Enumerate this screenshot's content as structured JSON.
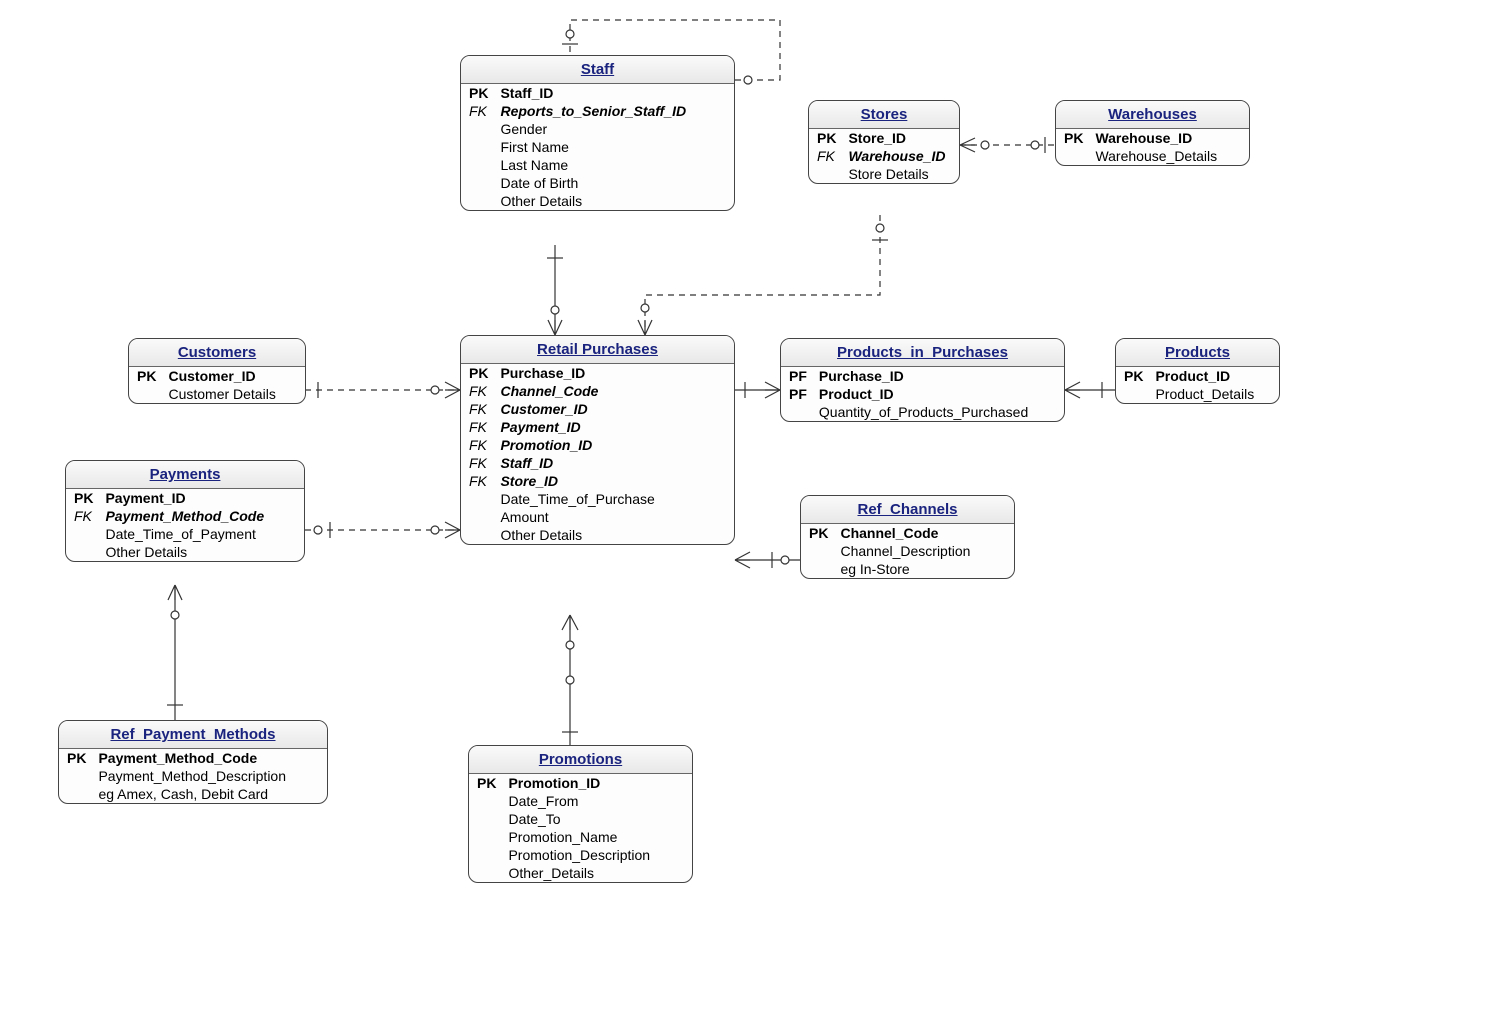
{
  "entities": {
    "staff": {
      "title": "Staff",
      "attrs": [
        {
          "key": "PK",
          "name": "Staff_ID"
        },
        {
          "key": "FK",
          "name": "Reports_to_Senior_Staff_ID",
          "italic": true
        },
        {
          "key": "",
          "name": "Gender",
          "plain": true
        },
        {
          "key": "",
          "name": "First Name",
          "plain": true
        },
        {
          "key": "",
          "name": "Last Name",
          "plain": true
        },
        {
          "key": "",
          "name": "Date of Birth",
          "plain": true
        },
        {
          "key": "",
          "name": "Other Details",
          "plain": true
        }
      ]
    },
    "stores": {
      "title": "Stores",
      "attrs": [
        {
          "key": "PK",
          "name": "Store_ID"
        },
        {
          "key": "FK",
          "name": "Warehouse_ID",
          "italic": true
        },
        {
          "key": "",
          "name": "Store Details",
          "plain": true
        }
      ]
    },
    "warehouses": {
      "title": "Warehouses",
      "attrs": [
        {
          "key": "PK",
          "name": "Warehouse_ID"
        },
        {
          "key": "",
          "name": "Warehouse_Details",
          "plain": true
        }
      ]
    },
    "customers": {
      "title": "Customers",
      "attrs": [
        {
          "key": "PK",
          "name": "Customer_ID"
        },
        {
          "key": "",
          "name": "Customer Details",
          "plain": true
        }
      ]
    },
    "retail_purchases": {
      "title": "Retail Purchases",
      "attrs": [
        {
          "key": "PK",
          "name": "Purchase_ID"
        },
        {
          "key": "FK",
          "name": "Channel_Code",
          "italic": true
        },
        {
          "key": "FK",
          "name": "Customer_ID",
          "italic": true
        },
        {
          "key": "FK",
          "name": "Payment_ID",
          "italic": true
        },
        {
          "key": "FK",
          "name": "Promotion_ID",
          "italic": true
        },
        {
          "key": "FK",
          "name": "Staff_ID",
          "italic": true
        },
        {
          "key": "FK",
          "name": "Store_ID",
          "italic": true
        },
        {
          "key": "",
          "name": "Date_Time_of_Purchase",
          "plain": true
        },
        {
          "key": "",
          "name": "Amount",
          "plain": true
        },
        {
          "key": "",
          "name": "Other Details",
          "plain": true
        }
      ]
    },
    "products_in_purchases": {
      "title": "Products_in_Purchases",
      "attrs": [
        {
          "key": "PF",
          "name": "Purchase_ID"
        },
        {
          "key": "PF",
          "name": "Product_ID"
        },
        {
          "key": "",
          "name": "Quantity_of_Products_Purchased",
          "plain": true
        }
      ]
    },
    "products": {
      "title": "Products",
      "attrs": [
        {
          "key": "PK",
          "name": "Product_ID"
        },
        {
          "key": "",
          "name": "Product_Details",
          "plain": true
        }
      ]
    },
    "payments": {
      "title": "Payments",
      "attrs": [
        {
          "key": "PK",
          "name": "Payment_ID"
        },
        {
          "key": "FK",
          "name": "Payment_Method_Code",
          "italic": true
        },
        {
          "key": "",
          "name": "Date_Time_of_Payment",
          "plain": true
        },
        {
          "key": "",
          "name": "Other Details",
          "plain": true
        }
      ]
    },
    "ref_channels": {
      "title": "Ref_Channels",
      "attrs": [
        {
          "key": "PK",
          "name": "Channel_Code"
        },
        {
          "key": "",
          "name": "Channel_Description",
          "plain": true
        },
        {
          "key": "",
          "name": "eg In-Store",
          "plain": true
        }
      ]
    },
    "ref_payment_methods": {
      "title": "Ref_Payment_Methods",
      "attrs": [
        {
          "key": "PK",
          "name": "Payment_Method_Code"
        },
        {
          "key": "",
          "name": "Payment_Method_Description",
          "plain": true
        },
        {
          "key": "",
          "name": "eg Amex, Cash, Debit Card",
          "plain": true
        }
      ]
    },
    "promotions": {
      "title": "Promotions",
      "attrs": [
        {
          "key": "PK",
          "name": "Promotion_ID"
        },
        {
          "key": "",
          "name": "Date_From",
          "plain": true
        },
        {
          "key": "",
          "name": "Date_To",
          "plain": true
        },
        {
          "key": "",
          "name": "Promotion_Name",
          "plain": true
        },
        {
          "key": "",
          "name": "Promotion_Description",
          "plain": true
        },
        {
          "key": "",
          "name": "Other_Details",
          "plain": true
        }
      ]
    }
  },
  "chart_data": {
    "type": "er-diagram",
    "entities": [
      "Staff",
      "Stores",
      "Warehouses",
      "Customers",
      "Retail Purchases",
      "Products_in_Purchases",
      "Products",
      "Payments",
      "Ref_Channels",
      "Ref_Payment_Methods",
      "Promotions"
    ],
    "relationships": [
      {
        "from": "Staff",
        "to": "Staff",
        "type": "self-reference",
        "note": "Reports_to_Senior_Staff_ID"
      },
      {
        "from": "Stores",
        "to": "Warehouses",
        "type": "many-to-one"
      },
      {
        "from": "Retail Purchases",
        "to": "Staff",
        "type": "many-to-one"
      },
      {
        "from": "Retail Purchases",
        "to": "Stores",
        "type": "many-to-one"
      },
      {
        "from": "Retail Purchases",
        "to": "Customers",
        "type": "many-to-one"
      },
      {
        "from": "Retail Purchases",
        "to": "Payments",
        "type": "many-to-one"
      },
      {
        "from": "Retail Purchases",
        "to": "Promotions",
        "type": "many-to-one"
      },
      {
        "from": "Retail Purchases",
        "to": "Ref_Channels",
        "type": "many-to-one"
      },
      {
        "from": "Products_in_Purchases",
        "to": "Retail Purchases",
        "type": "many-to-one"
      },
      {
        "from": "Products_in_Purchases",
        "to": "Products",
        "type": "many-to-one"
      },
      {
        "from": "Payments",
        "to": "Ref_Payment_Methods",
        "type": "many-to-one"
      }
    ]
  }
}
